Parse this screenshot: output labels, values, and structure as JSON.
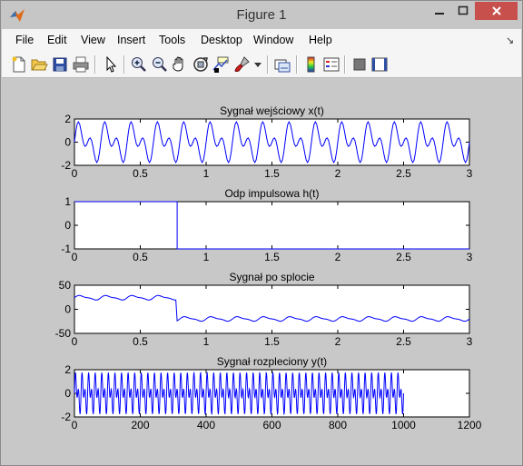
{
  "window": {
    "title": "Figure 1",
    "icon": "matlab-logo",
    "controls": [
      "minimize-icon",
      "maximize-icon",
      "close-icon"
    ]
  },
  "menu": {
    "items": [
      "File",
      "Edit",
      "View",
      "Insert",
      "Tools",
      "Desktop",
      "Window",
      "Help"
    ],
    "dock_glyph": "↘"
  },
  "toolbar": {
    "buttons": [
      "new-figure-icon",
      "open-file-icon",
      "save-icon",
      "print-icon",
      "edit-plot-arrow-icon",
      "zoom-in-icon",
      "zoom-out-icon",
      "pan-hand-icon",
      "rotate-3d-icon",
      "data-cursor-icon",
      "brush-icon",
      "link-plot-icon",
      "insert-colorbar-icon",
      "insert-legend-icon",
      "hide-plot-tools-icon",
      "show-plot-tools-icon"
    ]
  },
  "colors": {
    "line": "#0000ff",
    "figure_bg": "#c8c8c8",
    "axes_bg": "#ffffff",
    "close_button": "#c7504c"
  },
  "chart_data": [
    {
      "type": "line",
      "title": "Sygnał wejściowy x(t)",
      "xlabel": "",
      "ylabel": "",
      "xlim": [
        0,
        3
      ],
      "ylim": [
        -2,
        2
      ],
      "xticks": [
        "0",
        "0.5",
        "1",
        "1.5",
        "2",
        "2.5",
        "3"
      ],
      "yticks": [
        "2",
        "0",
        "-2"
      ],
      "series": [
        {
          "expression": "x(t) = sin(2π·5t) + sin(2π·10t)",
          "samples": 301,
          "x_range": [
            0,
            3
          ]
        }
      ]
    },
    {
      "type": "line",
      "title": "Odp impulsowa h(t)",
      "xlabel": "",
      "ylabel": "",
      "xlim": [
        0,
        3
      ],
      "ylim": [
        -1,
        1
      ],
      "xticks": [
        "0",
        "0.5",
        "1",
        "1.5",
        "2",
        "2.5",
        "3"
      ],
      "yticks": [
        "1",
        "0",
        "-1"
      ],
      "series": [
        {
          "x": [
            0,
            0.78,
            0.78,
            3
          ],
          "y": [
            1,
            1,
            -1,
            -1
          ]
        }
      ]
    },
    {
      "type": "line",
      "title": "Sygnał po splocie",
      "xlabel": "",
      "ylabel": "",
      "xlim": [
        0,
        3
      ],
      "ylim": [
        -50,
        50
      ],
      "xticks": [
        "0",
        "0.5",
        "1",
        "1.5",
        "2",
        "2.5",
        "3"
      ],
      "yticks": [
        "50",
        "0",
        "-50"
      ],
      "series": [
        {
          "expression": "piecewise: ≈ +24 + 4·sin(2π·5t) for t<0.78, then ≈ −20 + 4·sin(2π·5t)",
          "samples": 301,
          "x_range": [
            0,
            3
          ]
        }
      ]
    },
    {
      "type": "line",
      "title": "Sygnał rozpleciony y(t)",
      "xlabel": "",
      "ylabel": "",
      "xlim": [
        0,
        1200
      ],
      "ylim": [
        -2,
        2
      ],
      "xticks": [
        "0",
        "200",
        "400",
        "600",
        "800",
        "1000",
        "1200"
      ],
      "yticks": [
        "2",
        "0",
        "-2"
      ],
      "series": [
        {
          "expression": "y(n) = sin(2π·5·n/100) + sin(2π·10·n/100)",
          "samples": 1000,
          "x_range": [
            0,
            1000
          ]
        }
      ]
    }
  ]
}
